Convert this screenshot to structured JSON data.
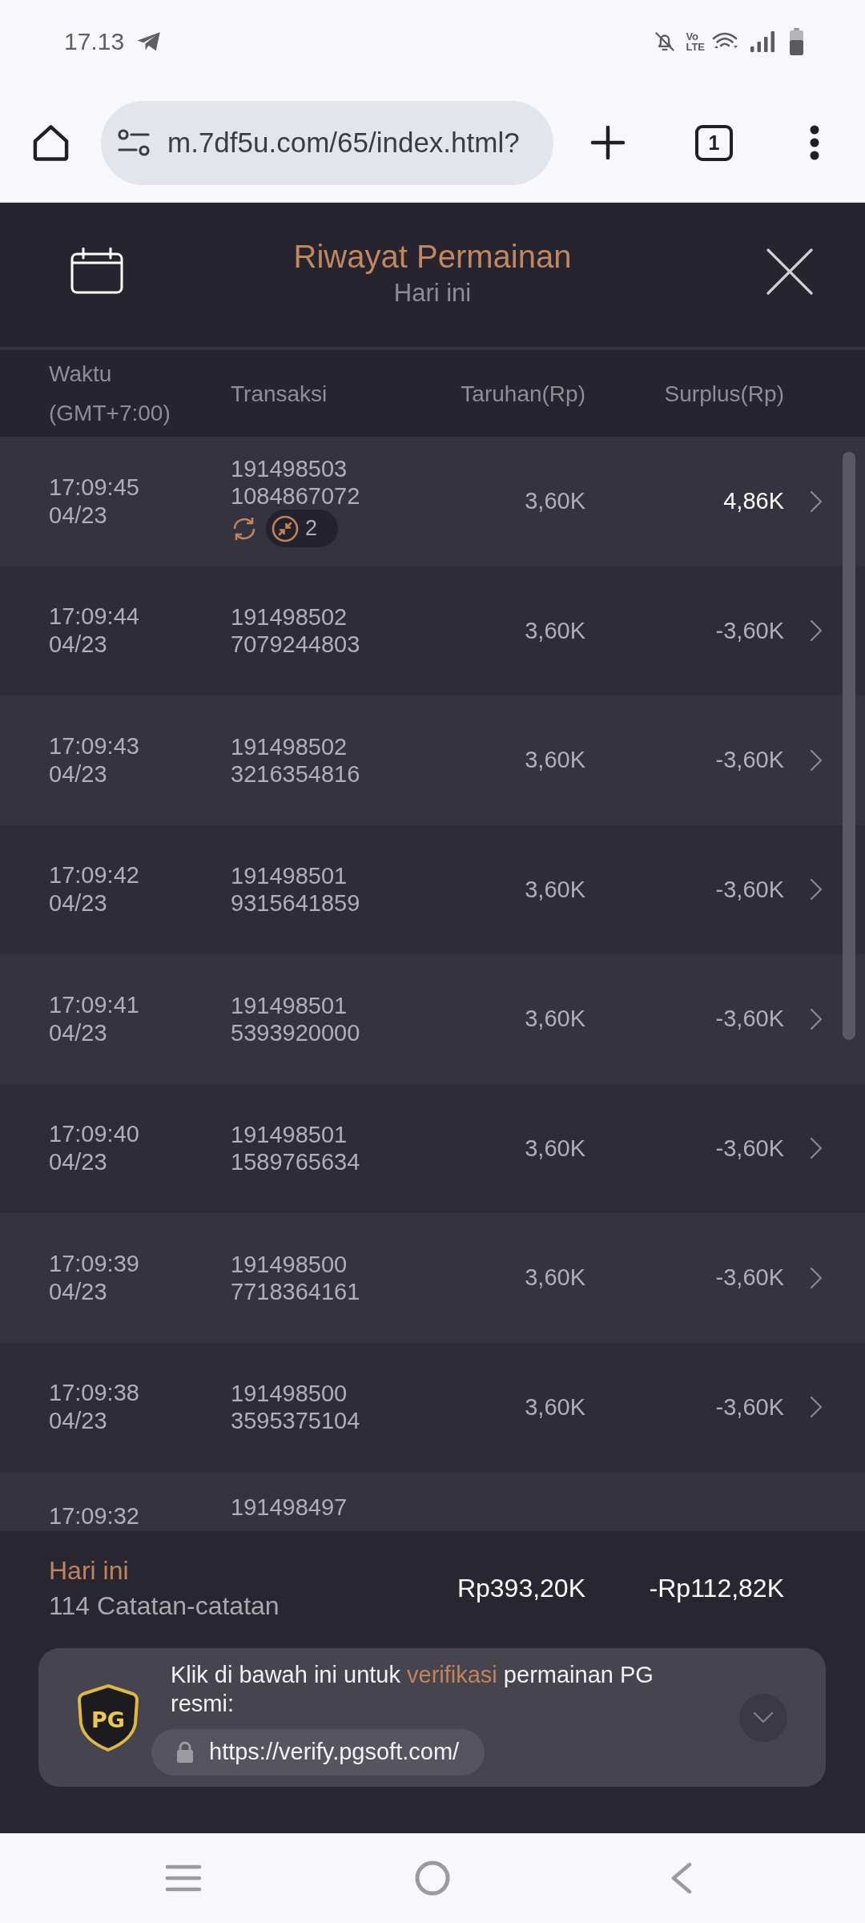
{
  "status_bar": {
    "time": "17.13",
    "network_label": {
      "top": "Vo",
      "bottom": "LTE"
    }
  },
  "browser": {
    "url": "m.7df5u.com/65/index.html?",
    "tab_count": "1"
  },
  "header": {
    "title": "Riwayat Permainan",
    "subtitle": "Hari ini"
  },
  "table": {
    "columns": [
      "Waktu (GMT+7:00)",
      "Transaksi",
      "Taruhan(Rp)",
      "Surplus(Rp)"
    ],
    "rows": [
      {
        "time": "17:09:45",
        "date": "04/23",
        "transaction": [
          "191498503",
          "1084867072"
        ],
        "bet": "3,60K",
        "surplus": "4,86K",
        "win": true,
        "badge": {
          "count": "2"
        }
      },
      {
        "time": "17:09:44",
        "date": "04/23",
        "transaction": [
          "191498502",
          "7079244803"
        ],
        "bet": "3,60K",
        "surplus": "-3,60K",
        "win": false
      },
      {
        "time": "17:09:43",
        "date": "04/23",
        "transaction": [
          "191498502",
          "3216354816"
        ],
        "bet": "3,60K",
        "surplus": "-3,60K",
        "win": false
      },
      {
        "time": "17:09:42",
        "date": "04/23",
        "transaction": [
          "191498501",
          "9315641859"
        ],
        "bet": "3,60K",
        "surplus": "-3,60K",
        "win": false
      },
      {
        "time": "17:09:41",
        "date": "04/23",
        "transaction": [
          "191498501",
          "5393920000"
        ],
        "bet": "3,60K",
        "surplus": "-3,60K",
        "win": false
      },
      {
        "time": "17:09:40",
        "date": "04/23",
        "transaction": [
          "191498501",
          "1589765634"
        ],
        "bet": "3,60K",
        "surplus": "-3,60K",
        "win": false
      },
      {
        "time": "17:09:39",
        "date": "04/23",
        "transaction": [
          "191498500",
          "7718364161"
        ],
        "bet": "3,60K",
        "surplus": "-3,60K",
        "win": false
      },
      {
        "time": "17:09:38",
        "date": "04/23",
        "transaction": [
          "191498500",
          "3595375104"
        ],
        "bet": "3,60K",
        "surplus": "-3,60K",
        "win": false
      }
    ],
    "partial_row": {
      "time": "17:09:32",
      "transaction": "191498497"
    }
  },
  "summary": {
    "label": "Hari ini",
    "records": "114 Catatan-catatan",
    "total_bet": "Rp393,20K",
    "total_surplus": "-Rp112,82K"
  },
  "verify": {
    "logo_text": "PG",
    "message": [
      {
        "text": "Klik di bawah ini untuk ",
        "highlight": false
      },
      {
        "text": "verifikasi",
        "highlight": true
      },
      {
        "text": " permainan PG resmi:",
        "highlight": false
      }
    ],
    "link": "https://verify.pgsoft.com/"
  }
}
